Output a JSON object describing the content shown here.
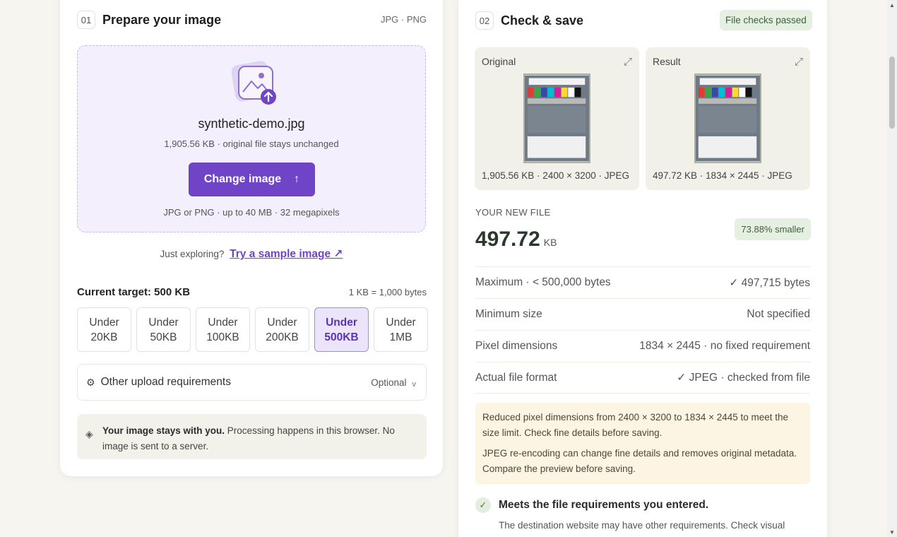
{
  "prepare": {
    "step": "01",
    "title": "Prepare your image",
    "formats": "JPG · PNG",
    "file_name": "synthetic-demo.jpg",
    "file_info": "1,905.56 KB · original file stays unchanged",
    "change_button": "Change image",
    "change_arrow": "↑",
    "limits": "JPG or PNG · up to 40 MB · 32 megapixels",
    "explore_prefix": "Just exploring?",
    "sample_link": "Try a sample image ↗",
    "target_label": "Current target: 500 KB",
    "target_unit": "1 KB = 1,000 bytes",
    "sizes": [
      {
        "line1": "Under",
        "line2": "20KB"
      },
      {
        "line1": "Under",
        "line2": "50KB"
      },
      {
        "line1": "Under",
        "line2": "100KB"
      },
      {
        "line1": "Under",
        "line2": "200KB"
      },
      {
        "line1": "Under",
        "line2": "500KB"
      },
      {
        "line1": "Under",
        "line2": "1MB"
      }
    ],
    "selected_size": "Under 500KB",
    "other_req_label": "Other upload requirements",
    "other_req_optional": "Optional",
    "privacy_bold": "Your image stays with you.",
    "privacy_text": " Processing happens in this browser. No image is sent to a server."
  },
  "check": {
    "step": "02",
    "title": "Check & save",
    "badge": "File checks passed",
    "original_label": "Original",
    "original_info": "1,905.56 KB · 2400 × 3200 · JPEG",
    "result_label": "Result",
    "result_info": "497.72 KB · 1834 × 2445 · JPEG",
    "new_file_label": "YOUR NEW FILE",
    "new_size": "497.72",
    "new_unit": "KB",
    "smaller": "73.88% smaller",
    "rows": [
      {
        "label": "Maximum · < 500,000 bytes",
        "value": "✓ 497,715 bytes"
      },
      {
        "label": "Minimum size",
        "value": "Not specified"
      },
      {
        "label": "Pixel dimensions",
        "value": "1834 × 2445 · no fixed requirement"
      },
      {
        "label": "Actual file format",
        "value": "✓ JPEG · checked from file"
      }
    ],
    "note1": "Reduced pixel dimensions from 2400 × 3200 to 1834 × 2445 to meet the size limit. Check fine details before saving.",
    "note2": "JPEG re-encoding can change fine details and removes original metadata. Compare the preview before saving.",
    "meets": "Meets the file requirements you entered.",
    "meets_sub": "The destination website may have other requirements. Check visual"
  },
  "colors": {
    "accent": "#7044c6",
    "success_bg": "#e6f0e2",
    "note_bg": "#fdf5e3"
  }
}
